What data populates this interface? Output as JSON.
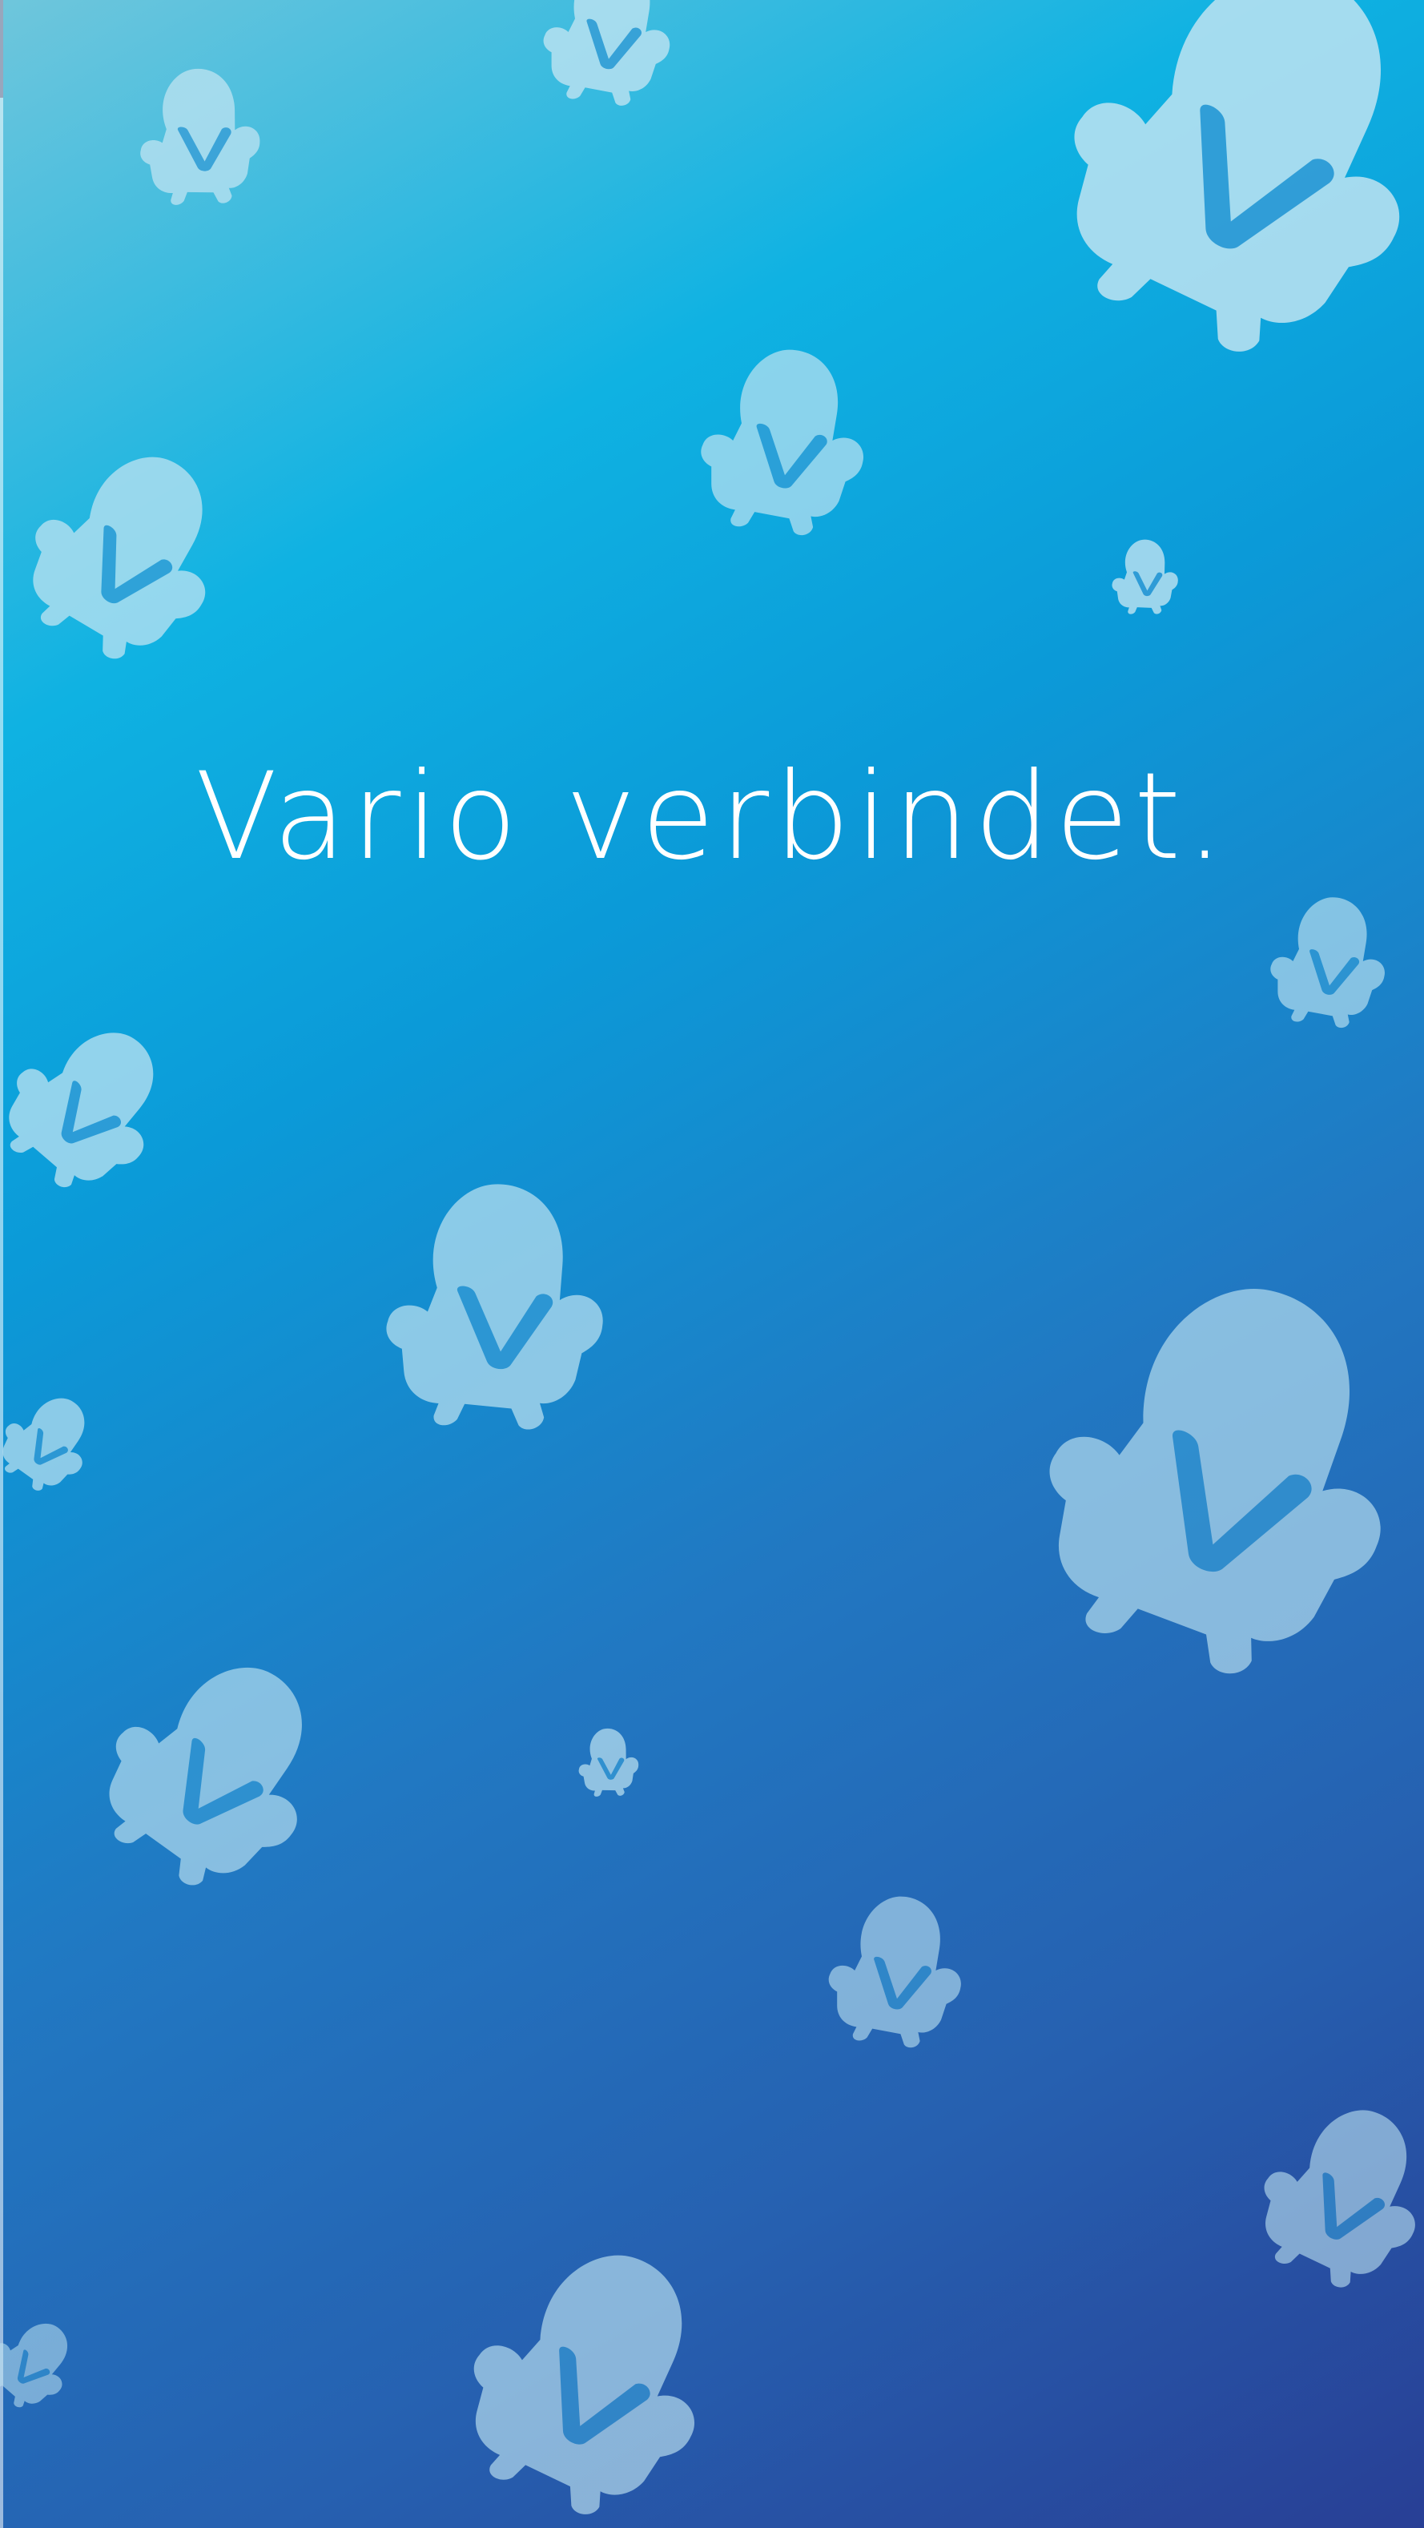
{
  "screen": {
    "tagline": "Vario verbindet.",
    "background": {
      "gradient_start": "#6fc6dc",
      "gradient_mid": "#0b9ad8",
      "gradient_end": "#283f95"
    },
    "mascot_icon": "vario-mascot-icon",
    "mascot_fill": "#bfe4f2",
    "checkmark_color": "#1e8fd1"
  }
}
